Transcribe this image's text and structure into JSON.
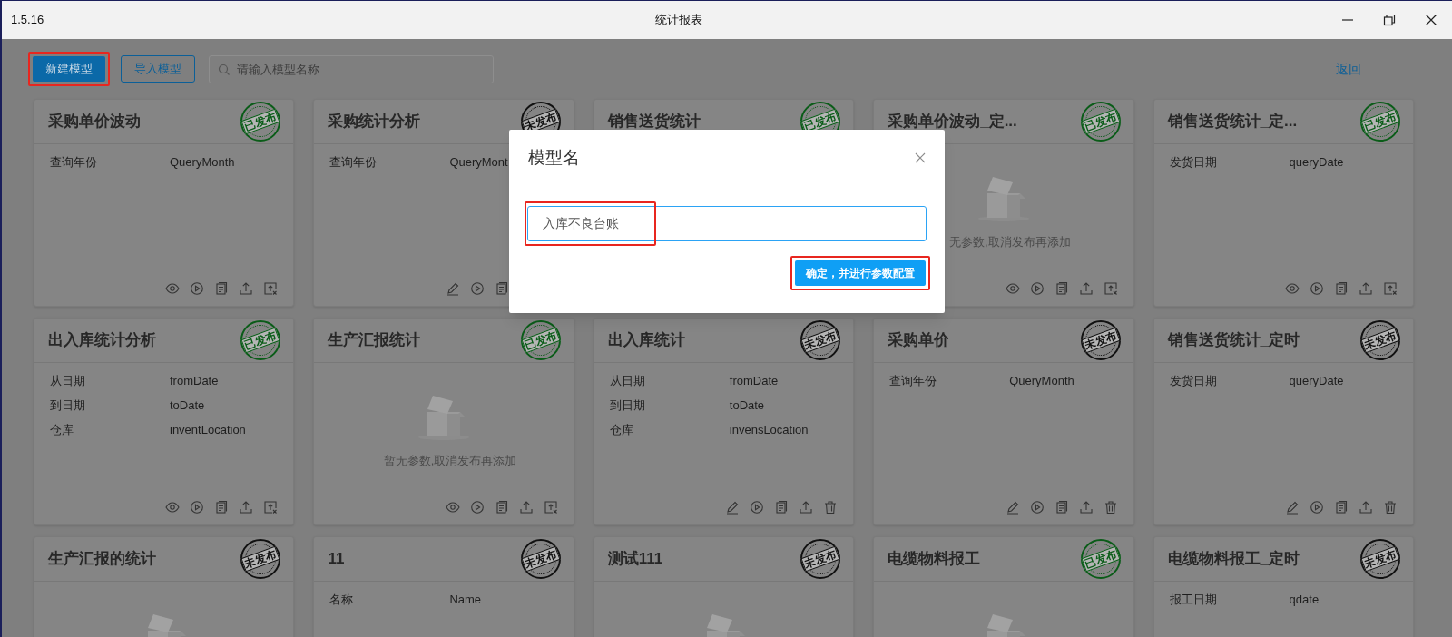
{
  "window": {
    "version": "1.5.16",
    "title": "统计报表"
  },
  "toolbar": {
    "new_button": {
      "label": "新建模型",
      "highlighted": true
    },
    "import_button": {
      "label": "导入模型"
    },
    "search": {
      "placeholder": "请输入模型名称"
    },
    "back_link": "返回"
  },
  "cards": [
    {
      "title": "采购单价波动",
      "published": true,
      "stamp": "已发布",
      "kind": "params",
      "params": [
        {
          "label": "查询年份",
          "value": "QueryMonth"
        }
      ]
    },
    {
      "title": "采购统计分析",
      "published": false,
      "stamp": "未发布",
      "kind": "params",
      "params": [
        {
          "label": "查询年份",
          "value": "QueryMont"
        }
      ]
    },
    {
      "title": "销售送货统计",
      "published": true,
      "stamp": "已发布",
      "kind": "params"
    },
    {
      "title": "采购单价波动_定...",
      "published": true,
      "stamp": "已发布",
      "kind": "empty",
      "empty_text": "无参数,取消发布再添加"
    },
    {
      "title": "销售送货统计_定...",
      "published": true,
      "stamp": "已发布",
      "kind": "params",
      "params": [
        {
          "label": "发货日期",
          "value": "queryDate"
        }
      ]
    },
    {
      "title": "出入库统计分析",
      "published": true,
      "stamp": "已发布",
      "kind": "params",
      "params": [
        {
          "label": "从日期",
          "value": "fromDate"
        },
        {
          "label": "到日期",
          "value": "toDate"
        },
        {
          "label": "仓库",
          "value": "inventLocation"
        }
      ]
    },
    {
      "title": "生产汇报统计",
      "published": true,
      "stamp": "已发布",
      "kind": "empty",
      "empty_text": "暂无参数,取消发布再添加"
    },
    {
      "title": "出入库统计",
      "published": false,
      "stamp": "未发布",
      "kind": "params",
      "params": [
        {
          "label": "从日期",
          "value": "fromDate"
        },
        {
          "label": "到日期",
          "value": "toDate"
        },
        {
          "label": "仓库",
          "value": "invensLocation"
        }
      ]
    },
    {
      "title": "采购单价",
      "published": false,
      "stamp": "未发布",
      "kind": "params",
      "params": [
        {
          "label": "查询年份",
          "value": "QueryMonth"
        }
      ]
    },
    {
      "title": "销售送货统计_定时",
      "published": false,
      "stamp": "未发布",
      "kind": "params",
      "params": [
        {
          "label": "发货日期",
          "value": "queryDate"
        }
      ]
    },
    {
      "title": "生产汇报的统计",
      "published": false,
      "stamp": "未发布",
      "kind": "empty"
    },
    {
      "title": "11",
      "published": false,
      "stamp": "未发布",
      "kind": "params",
      "params": [
        {
          "label": "名称",
          "value": "Name"
        }
      ]
    },
    {
      "title": "测试111",
      "published": false,
      "stamp": "未发布",
      "kind": "empty"
    },
    {
      "title": "电缆物料报工",
      "published": true,
      "stamp": "已发布",
      "kind": "empty"
    },
    {
      "title": "电缆物料报工_定时",
      "published": false,
      "stamp": "未发布",
      "kind": "params",
      "params": [
        {
          "label": "报工日期",
          "value": "qdate"
        }
      ]
    }
  ],
  "dialog": {
    "title": "模型名",
    "input": {
      "value": "入库不良台账",
      "highlighted": true
    },
    "confirm_button": {
      "label": "确定，并进行参数配置",
      "highlighted": true
    }
  }
}
